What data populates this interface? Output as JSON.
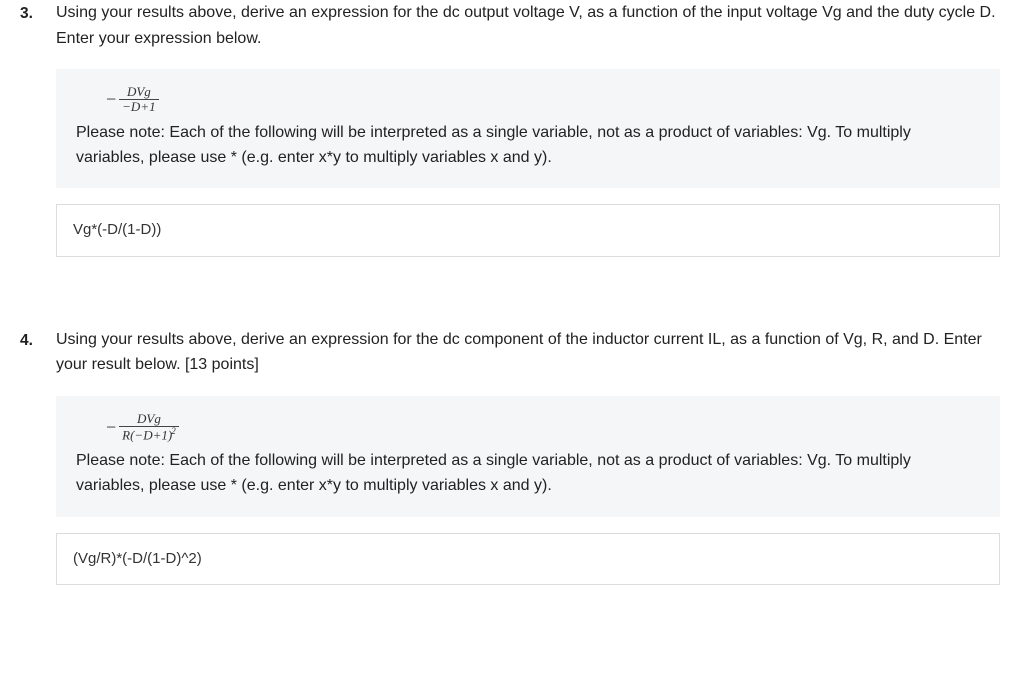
{
  "questions": [
    {
      "number": "3.",
      "prompt": "Using your results above, derive an expression for the dc output voltage V, as a function of the input voltage Vg and the duty cycle D. Enter your expression below.",
      "formula": {
        "leading_minus": "−",
        "numerator": "DVg",
        "denominator": "−D+1"
      },
      "note": "Please note: Each of the following will be interpreted as a single variable, not as a product of variables: Vg. To multiply variables, please use * (e.g. enter x*y to multiply variables x and y).",
      "answer": "Vg*(-D/(1-D))"
    },
    {
      "number": "4.",
      "prompt": "Using your results above, derive an expression for the dc component of the inductor current IL, as a function of Vg, R, and D. Enter your result below. [13 points]",
      "formula": {
        "leading_minus": "−",
        "numerator": "DVg",
        "denominator_base": "R(−D+1)",
        "denominator_exp": "2"
      },
      "note": "Please note: Each of the following will be interpreted as a single variable, not as a product of variables: Vg. To multiply variables, please use * (e.g. enter x*y to multiply variables x and y).",
      "answer": "(Vg/R)*(-D/(1-D)^2)"
    }
  ]
}
